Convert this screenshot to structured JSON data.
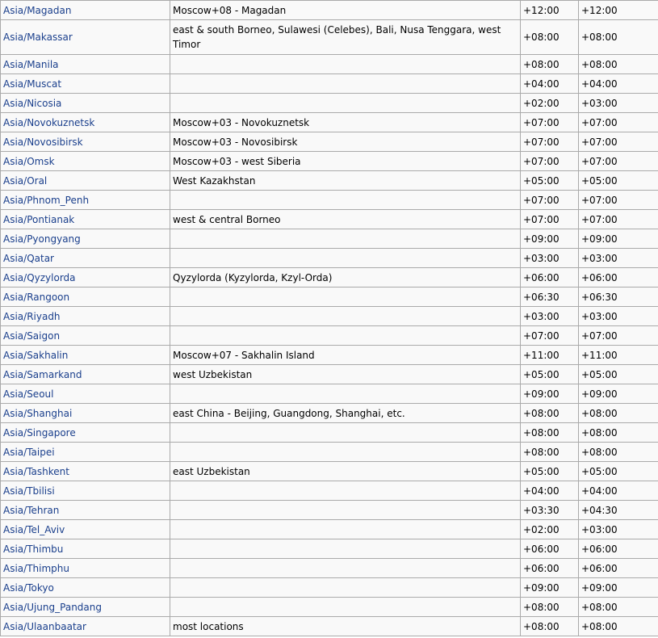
{
  "rows": [
    {
      "tz": "Asia/Magadan",
      "comment": "Moscow+08 - Magadan",
      "std": "+12:00",
      "dst": "+12:00"
    },
    {
      "tz": "Asia/Makassar",
      "comment": "east & south Borneo, Sulawesi (Celebes), Bali, Nusa Tenggara, west Timor",
      "std": "+08:00",
      "dst": "+08:00"
    },
    {
      "tz": "Asia/Manila",
      "comment": "",
      "std": "+08:00",
      "dst": "+08:00"
    },
    {
      "tz": "Asia/Muscat",
      "comment": "",
      "std": "+04:00",
      "dst": "+04:00"
    },
    {
      "tz": "Asia/Nicosia",
      "comment": "",
      "std": "+02:00",
      "dst": "+03:00"
    },
    {
      "tz": "Asia/Novokuznetsk",
      "comment": "Moscow+03 - Novokuznetsk",
      "std": "+07:00",
      "dst": "+07:00"
    },
    {
      "tz": "Asia/Novosibirsk",
      "comment": "Moscow+03 - Novosibirsk",
      "std": "+07:00",
      "dst": "+07:00"
    },
    {
      "tz": "Asia/Omsk",
      "comment": "Moscow+03 - west Siberia",
      "std": "+07:00",
      "dst": "+07:00"
    },
    {
      "tz": "Asia/Oral",
      "comment": "West Kazakhstan",
      "std": "+05:00",
      "dst": "+05:00"
    },
    {
      "tz": "Asia/Phnom_Penh",
      "comment": "",
      "std": "+07:00",
      "dst": "+07:00"
    },
    {
      "tz": "Asia/Pontianak",
      "comment": "west & central Borneo",
      "std": "+07:00",
      "dst": "+07:00"
    },
    {
      "tz": "Asia/Pyongyang",
      "comment": "",
      "std": "+09:00",
      "dst": "+09:00"
    },
    {
      "tz": "Asia/Qatar",
      "comment": "",
      "std": "+03:00",
      "dst": "+03:00"
    },
    {
      "tz": "Asia/Qyzylorda",
      "comment": "Qyzylorda (Kyzylorda, Kzyl-Orda)",
      "std": "+06:00",
      "dst": "+06:00"
    },
    {
      "tz": "Asia/Rangoon",
      "comment": "",
      "std": "+06:30",
      "dst": "+06:30"
    },
    {
      "tz": "Asia/Riyadh",
      "comment": "",
      "std": "+03:00",
      "dst": "+03:00"
    },
    {
      "tz": "Asia/Saigon",
      "comment": "",
      "std": "+07:00",
      "dst": "+07:00"
    },
    {
      "tz": "Asia/Sakhalin",
      "comment": "Moscow+07 - Sakhalin Island",
      "std": "+11:00",
      "dst": "+11:00"
    },
    {
      "tz": "Asia/Samarkand",
      "comment": "west Uzbekistan",
      "std": "+05:00",
      "dst": "+05:00"
    },
    {
      "tz": "Asia/Seoul",
      "comment": "",
      "std": "+09:00",
      "dst": "+09:00"
    },
    {
      "tz": "Asia/Shanghai",
      "comment": "east China - Beijing, Guangdong, Shanghai, etc.",
      "std": "+08:00",
      "dst": "+08:00"
    },
    {
      "tz": "Asia/Singapore",
      "comment": "",
      "std": "+08:00",
      "dst": "+08:00"
    },
    {
      "tz": "Asia/Taipei",
      "comment": "",
      "std": "+08:00",
      "dst": "+08:00"
    },
    {
      "tz": "Asia/Tashkent",
      "comment": "east Uzbekistan",
      "std": "+05:00",
      "dst": "+05:00"
    },
    {
      "tz": "Asia/Tbilisi",
      "comment": "",
      "std": "+04:00",
      "dst": "+04:00"
    },
    {
      "tz": "Asia/Tehran",
      "comment": "",
      "std": "+03:30",
      "dst": "+04:30"
    },
    {
      "tz": "Asia/Tel_Aviv",
      "comment": "",
      "std": "+02:00",
      "dst": "+03:00"
    },
    {
      "tz": "Asia/Thimbu",
      "comment": "",
      "std": "+06:00",
      "dst": "+06:00"
    },
    {
      "tz": "Asia/Thimphu",
      "comment": "",
      "std": "+06:00",
      "dst": "+06:00"
    },
    {
      "tz": "Asia/Tokyo",
      "comment": "",
      "std": "+09:00",
      "dst": "+09:00"
    },
    {
      "tz": "Asia/Ujung_Pandang",
      "comment": "",
      "std": "+08:00",
      "dst": "+08:00"
    },
    {
      "tz": "Asia/Ulaanbaatar",
      "comment": "most locations",
      "std": "+08:00",
      "dst": "+08:00"
    }
  ]
}
